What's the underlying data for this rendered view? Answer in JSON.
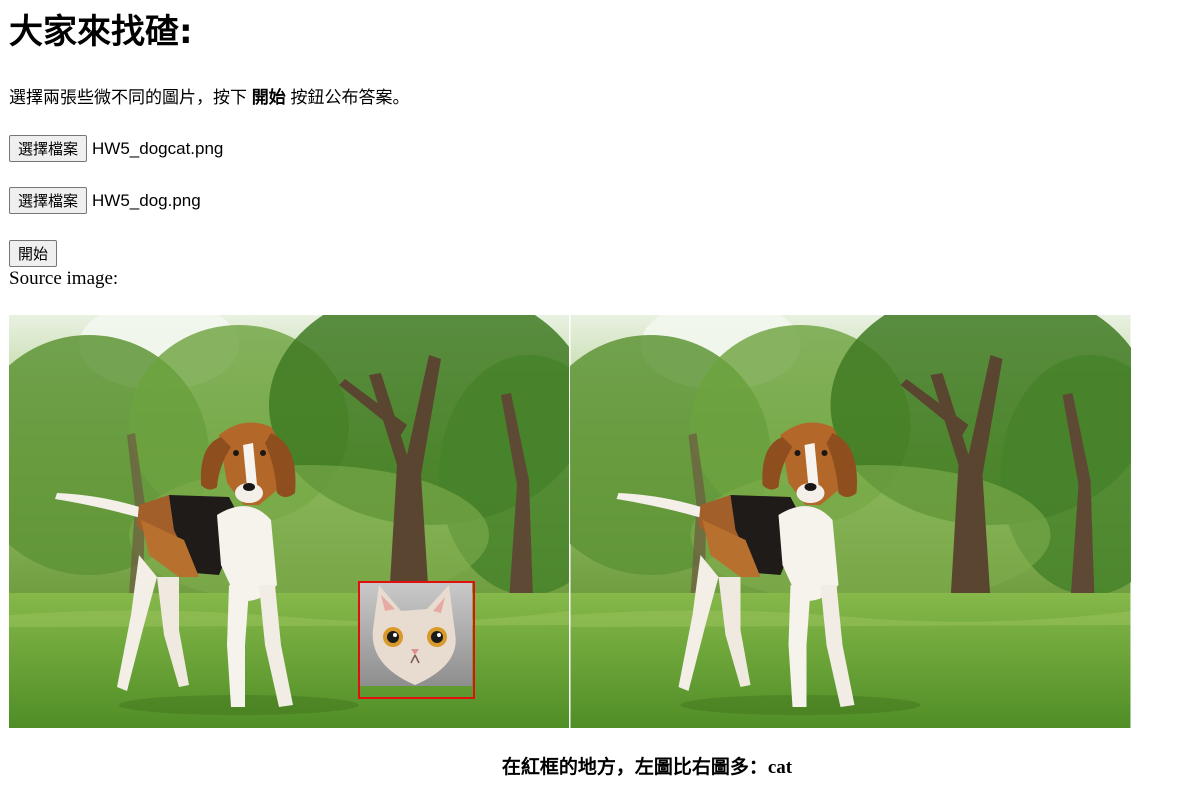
{
  "title": "大家來找碴:",
  "intro": {
    "before": "選擇兩張些微不同的圖片，按下 ",
    "bold": "開始",
    "after": " 按鈕公布答案。"
  },
  "file_inputs": [
    {
      "button_label": "選擇檔案",
      "file_name": "HW5_dogcat.png"
    },
    {
      "button_label": "選擇檔案",
      "file_name": "HW5_dog.png"
    }
  ],
  "start_button_label": "開始",
  "source_label": "Source image:",
  "result": {
    "prefix": "在紅框的地方，左圖比右圖多：",
    "answer": "cat"
  },
  "colors": {
    "highlight_box": "#e01010",
    "grass": "#5f9a32",
    "foliage": "#3f7a22"
  },
  "images": [
    {
      "name": "left-source-image",
      "content": "beagle in park with pasted cat"
    },
    {
      "name": "right-source-image",
      "content": "beagle in park"
    }
  ]
}
